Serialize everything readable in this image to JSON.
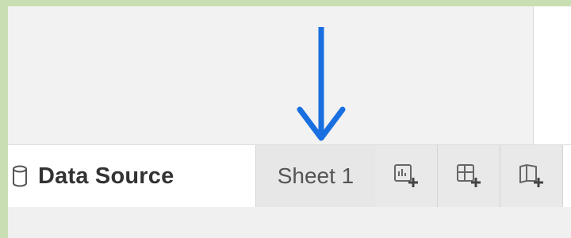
{
  "tabs": {
    "data_source": {
      "label": "Data Source",
      "icon": "database-icon"
    },
    "sheet": {
      "label": "Sheet 1"
    },
    "new_worksheet": {
      "icon": "new-worksheet-icon"
    },
    "new_dashboard": {
      "icon": "new-dashboard-icon"
    },
    "new_story": {
      "icon": "new-story-icon"
    }
  },
  "annotation": {
    "icon": "arrow-down-icon",
    "color": "#1a6fe0"
  },
  "colors": {
    "frame": "#c9dfb3",
    "workspace": "#f2f2f2",
    "tab_active": "#e7e7e7",
    "icon_gray": "#666666"
  }
}
